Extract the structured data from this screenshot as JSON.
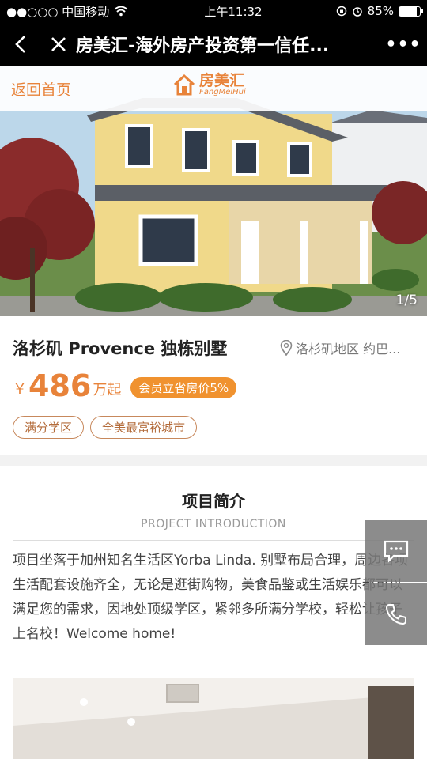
{
  "status_bar": {
    "carrier": "●●○○○ 中国移动",
    "time": "上午11:32",
    "battery": "85%",
    "battery_level": 0.85
  },
  "nav": {
    "title": "房美汇-海外房产投资第一信任..."
  },
  "hero": {
    "home_link": "返回首页",
    "logo_cn": "房美汇",
    "logo_en": "FangMeiHui",
    "counter": "1/5"
  },
  "property": {
    "title": "洛杉矶 Provence 独栋别墅",
    "location": "洛杉矶地区 约巴...",
    "currency": "￥",
    "price": "486",
    "price_unit": "万起",
    "discount": "会员立省房价5%",
    "tags": [
      "满分学区",
      "全美最富裕城市"
    ]
  },
  "intro": {
    "title": "项目简介",
    "subtitle": "PROJECT INTRODUCTION",
    "body": "项目坐落于加州知名生活区Yorba Linda. 别墅布局合理，周边各项生活配套设施齐全，无论是逛街购物，美食品鉴或生活娱乐都可以满足您的需求，因地处顶级学区，紧邻多所满分学校，轻松让孩子上名校！Welcome home!"
  },
  "colors": {
    "accent": "#e8833a",
    "badge": "#f0922f"
  }
}
